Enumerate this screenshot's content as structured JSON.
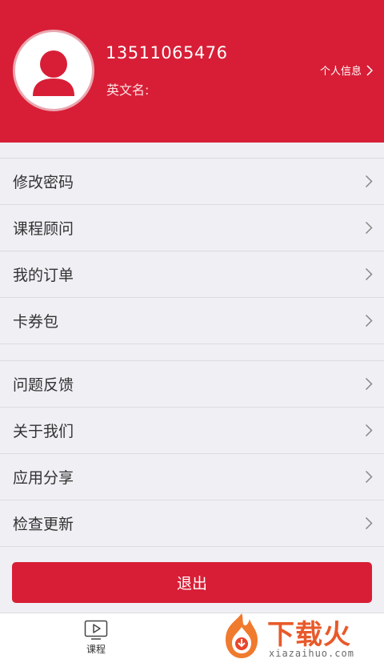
{
  "header": {
    "phone": "13511065476",
    "english_name_label": "英文名:",
    "profile_link": "个人信息",
    "bg_color": "#d81e36"
  },
  "menu_group_1": [
    {
      "label": "修改密码"
    },
    {
      "label": "课程顾问"
    },
    {
      "label": "我的订单"
    },
    {
      "label": "卡券包"
    }
  ],
  "menu_group_2": [
    {
      "label": "问题反馈"
    },
    {
      "label": "关于我们"
    },
    {
      "label": "应用分享"
    },
    {
      "label": "检查更新"
    }
  ],
  "logout_label": "退出",
  "tabbar": {
    "items": [
      {
        "label": "课程",
        "icon": "video-icon"
      }
    ]
  },
  "watermark": {
    "title": "下载火",
    "domain": "xiazaihuo.com",
    "logo_icon": "flame-logo-icon"
  }
}
